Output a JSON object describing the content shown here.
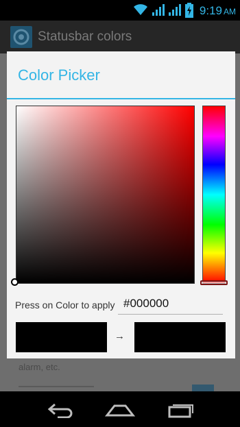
{
  "status_bar": {
    "time": "9:19",
    "ampm": "AM",
    "icons": [
      "wifi-icon",
      "signal-icon",
      "signal-icon",
      "battery-charging-icon"
    ],
    "accent": "#33b5e5"
  },
  "app_bar": {
    "title": "Statusbar colors",
    "icon": "gear-icon"
  },
  "background_content": {
    "visible_text": "alarm, etc."
  },
  "dialog": {
    "title": "Color Picker",
    "accent": "#33b5e5",
    "picker": {
      "base_hue": "#ff0000",
      "hue_selection": "red"
    },
    "apply_label": "Press on Color to apply",
    "hex_value": "#000000",
    "old_color": "#000000",
    "new_color": "#000000",
    "arrow": "→"
  },
  "nav_bar": {
    "buttons": [
      "back-icon",
      "home-icon",
      "recent-apps-icon"
    ]
  }
}
